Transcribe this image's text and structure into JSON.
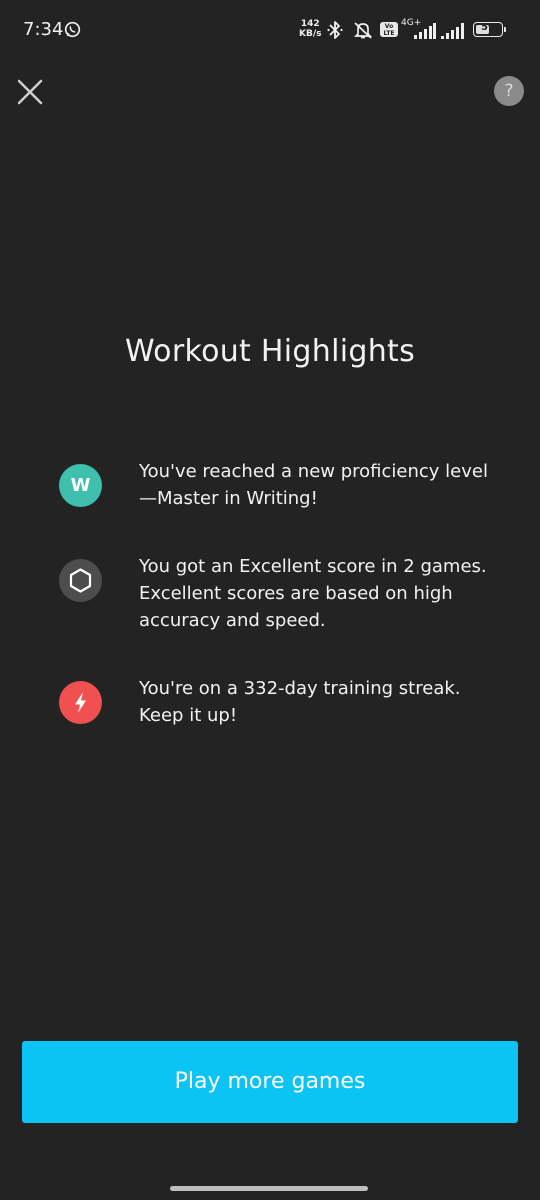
{
  "status_bar": {
    "time": "7:34",
    "net_speed_value": "142",
    "net_speed_unit": "KB/s",
    "volte_top": "Vo",
    "volte_bottom": "LTE",
    "network_type": "4G+",
    "battery": "59",
    "battery_fraction": 0.59,
    "icons": [
      "whatsapp-icon",
      "bluetooth-icon",
      "mute-icon",
      "volte-icon",
      "signal-icon",
      "signal-icon",
      "battery-icon"
    ]
  },
  "header": {
    "close_icon": "close-icon",
    "help_label": "?"
  },
  "title": "Workout Highlights",
  "highlights": [
    {
      "icon": "writing-badge-icon",
      "icon_label": "W",
      "icon_color": "#3fbfae",
      "line1": "You've reached a new proficiency level",
      "line2": "—Master in Writing!"
    },
    {
      "icon": "hexagon-icon",
      "icon_color": "#4d4d4d",
      "line1": "You got an Excellent score in 2 games.",
      "line2": "Excellent scores are based on high",
      "line3": "accuracy and speed."
    },
    {
      "icon": "lightning-icon",
      "icon_color": "#f0504f",
      "line1": "You're on a 332-day training streak.",
      "line2": "Keep it up!"
    }
  ],
  "cta": {
    "label": "Play more games",
    "color": "#0bc3f5"
  }
}
